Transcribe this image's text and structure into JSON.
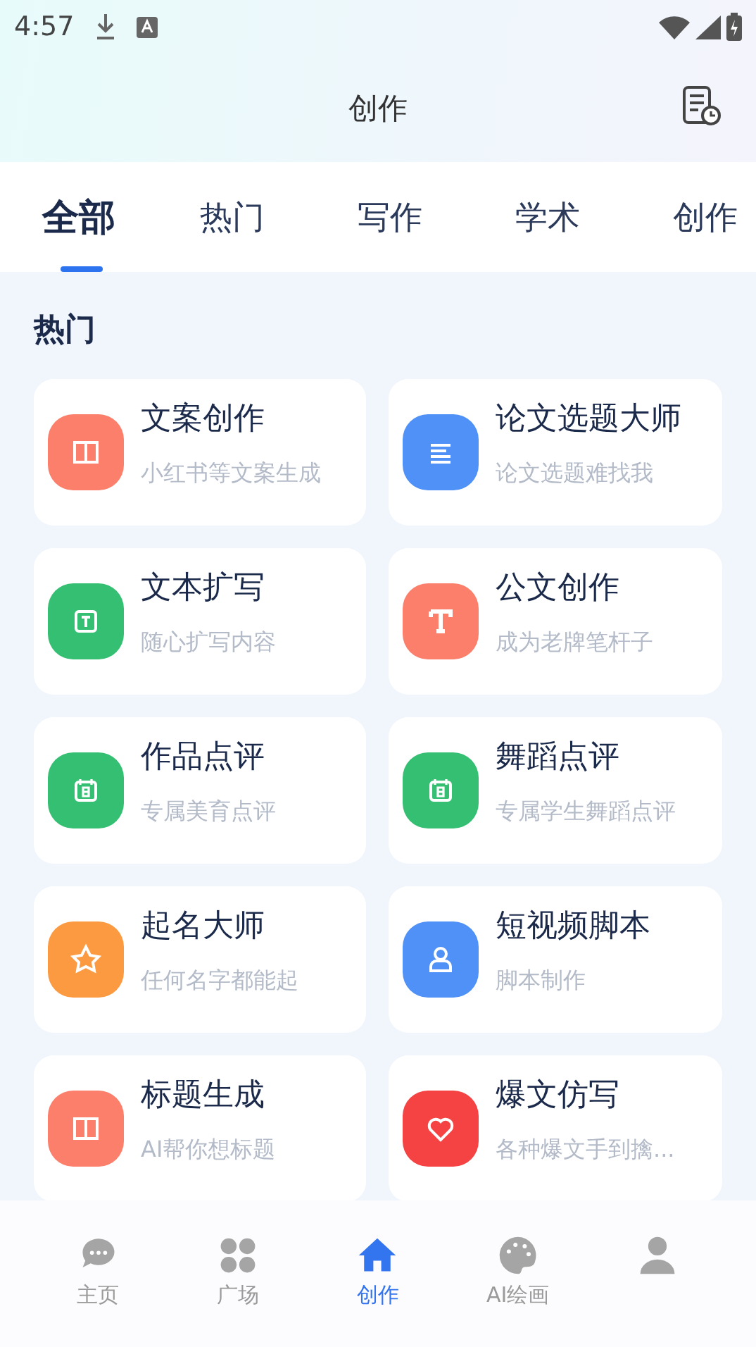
{
  "status_bar": {
    "time": "4:57"
  },
  "header": {
    "title": "创作"
  },
  "tabs": [
    {
      "label": "全部",
      "selected": true
    },
    {
      "label": "热门",
      "selected": false
    },
    {
      "label": "写作",
      "selected": false
    },
    {
      "label": "学术",
      "selected": false
    },
    {
      "label": "创作",
      "selected": false
    }
  ],
  "section": {
    "title": "热门"
  },
  "cards": [
    {
      "title": "文案创作",
      "subtitle": "小红书等文案生成",
      "kind": "book",
      "color": "#fb7f6b"
    },
    {
      "title": "论文选题大师",
      "subtitle": "论文选题难找我",
      "kind": "lines",
      "color": "#4f91f7"
    },
    {
      "title": "文本扩写",
      "subtitle": "随心扩写内容",
      "kind": "tbox",
      "color": "#35bf72"
    },
    {
      "title": "公文创作",
      "subtitle": "成为老牌笔杆子",
      "kind": "tletter",
      "color": "#fb7f6b"
    },
    {
      "title": "作品点评",
      "subtitle": "专属美育点评",
      "kind": "calendar",
      "color": "#35bf72"
    },
    {
      "title": "舞蹈点评",
      "subtitle": "专属学生舞蹈点评",
      "kind": "calendar",
      "color": "#35bf72"
    },
    {
      "title": "起名大师",
      "subtitle": "任何名字都能起",
      "kind": "star",
      "color": "#fc9a42"
    },
    {
      "title": "短视频脚本",
      "subtitle": "脚本制作",
      "kind": "person",
      "color": "#4f91f7"
    },
    {
      "title": "标题生成",
      "subtitle": "AI帮你想标题",
      "kind": "book",
      "color": "#fb7f6b"
    },
    {
      "title": "爆文仿写",
      "subtitle": "各种爆文手到擒...",
      "kind": "heart",
      "color": "#f54343"
    }
  ],
  "nav": [
    {
      "label": "主页",
      "kind": "chat",
      "selected": false
    },
    {
      "label": "广场",
      "kind": "grid",
      "selected": false
    },
    {
      "label": "创作",
      "kind": "home",
      "selected": true
    },
    {
      "label": "AI绘画",
      "kind": "palette",
      "selected": false
    },
    {
      "kind": "user",
      "selected": false
    }
  ]
}
